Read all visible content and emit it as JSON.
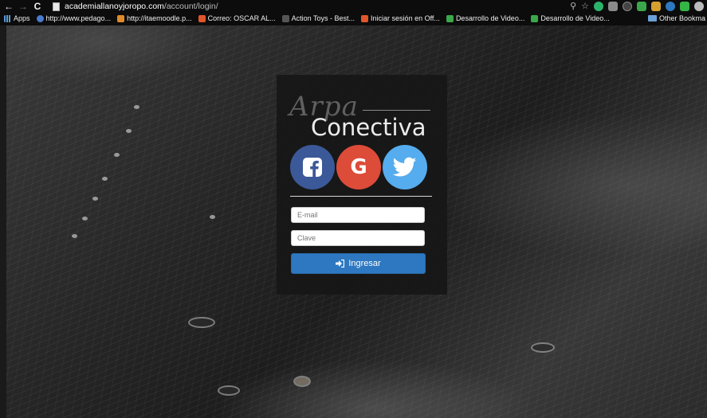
{
  "browser": {
    "url_host": "academiallanoyjoropo.com",
    "url_path": "/account/login/",
    "bookmarks": [
      {
        "label": "Apps",
        "color": "#5a9bd8"
      },
      {
        "label": "http://www.pedago...",
        "color": "#4a7bd0"
      },
      {
        "label": "http://itaemoodle.p...",
        "color": "#e08a2a"
      },
      {
        "label": "Correo: OSCAR AL...",
        "color": "#e0562a"
      },
      {
        "label": "Action Toys - Best...",
        "color": "#555555"
      },
      {
        "label": "Iniciar sesión en Off...",
        "color": "#e0562a"
      },
      {
        "label": "Desarrollo de Video...",
        "color": "#3aa84a"
      },
      {
        "label": "Desarrollo de Video...",
        "color": "#3aa84a"
      }
    ],
    "other_bookmarks": "Other Bookma"
  },
  "login": {
    "logo_script": "Arpa",
    "logo_main": "Conectiva",
    "email_placeholder": "E-mail",
    "password_placeholder": "Clave",
    "submit_label": "Ingresar"
  },
  "colors": {
    "facebook": "#3b5998",
    "google": "#dd4b39",
    "twitter": "#55acee",
    "submit": "#2d78c1"
  }
}
